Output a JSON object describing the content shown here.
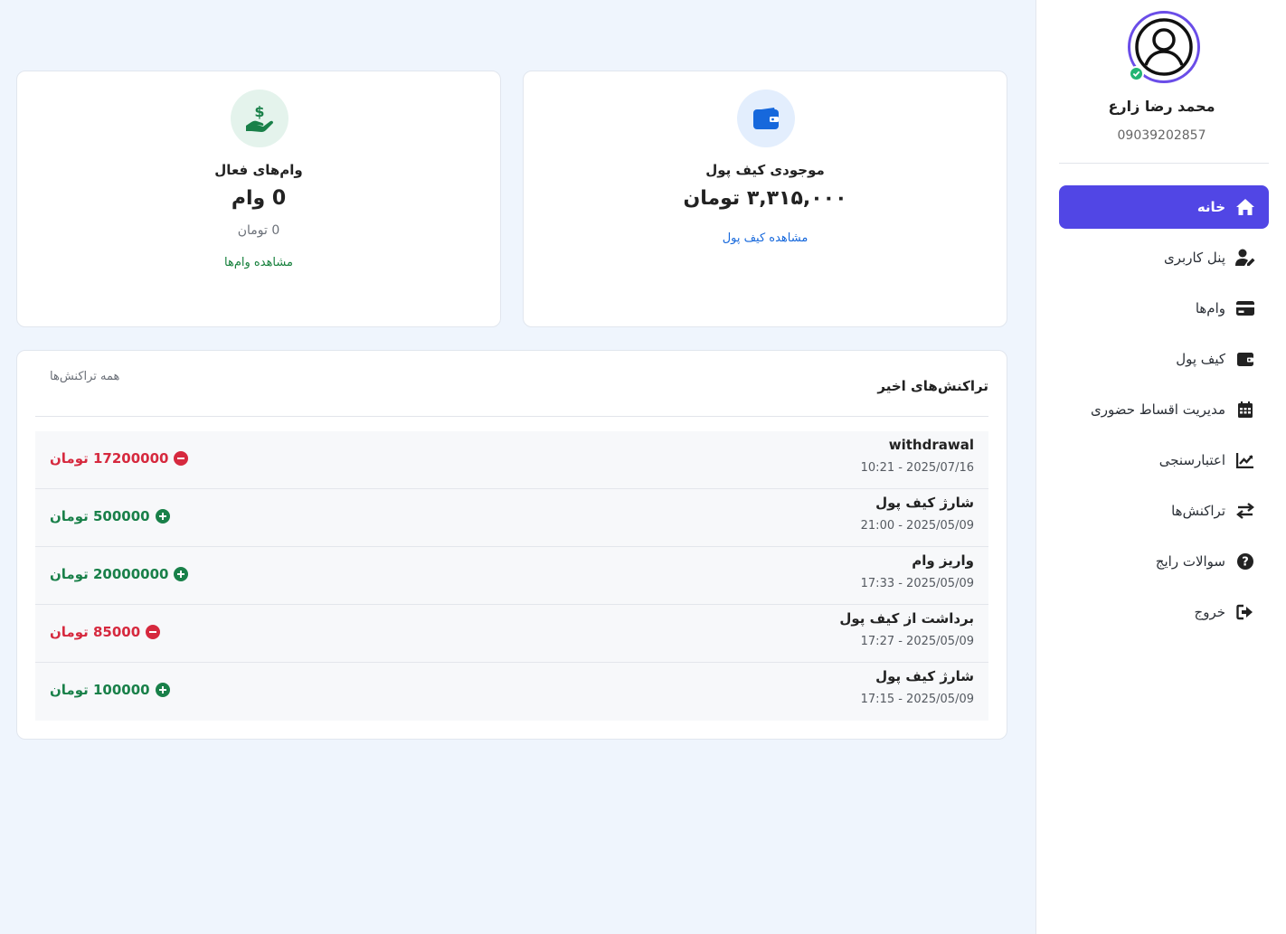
{
  "profile": {
    "name": "محمد رضا زارع",
    "phone": "09039202857"
  },
  "nav": {
    "items": [
      {
        "label": "خانه",
        "icon": "home-icon",
        "active": true
      },
      {
        "label": "پنل کاربری",
        "icon": "user-edit-icon",
        "active": false
      },
      {
        "label": "وام‌ها",
        "icon": "credit-card-icon",
        "active": false
      },
      {
        "label": "کیف پول",
        "icon": "wallet-icon",
        "active": false
      },
      {
        "label": "مدیریت اقساط حضوری",
        "icon": "calendar-icon",
        "active": false
      },
      {
        "label": "اعتبارسنجی",
        "icon": "chart-line-icon",
        "active": false
      },
      {
        "label": "تراکنش‌ها",
        "icon": "exchange-icon",
        "active": false
      },
      {
        "label": "سوالات رایج",
        "icon": "question-circle-icon",
        "active": false
      },
      {
        "label": "خروج",
        "icon": "sign-out-icon",
        "active": false
      }
    ]
  },
  "wallet_card": {
    "title": "موجودی کیف پول",
    "value": "۳,۳۱۵,۰۰۰ تومان",
    "link": "مشاهده کیف پول",
    "icon": "wallet-icon"
  },
  "loans_card": {
    "title": "وام‌های فعال",
    "value": "0 وام",
    "sub": "0 تومان",
    "link": "مشاهده وام‌ها",
    "icon": "hand-holding-dollar-icon"
  },
  "transactions": {
    "title": "تراکنش‌های اخیر",
    "all_link": "همه تراکنش‌ها",
    "rows": [
      {
        "name": "withdrawal",
        "date": "10:21 - 2025/07/16",
        "amount": "17200000 تومان",
        "type": "neg"
      },
      {
        "name": "شارژ کیف پول",
        "date": "21:00 - 2025/05/09",
        "amount": "500000 تومان",
        "type": "pos"
      },
      {
        "name": "واریز وام",
        "date": "17:33 - 2025/05/09",
        "amount": "20000000 تومان",
        "type": "pos"
      },
      {
        "name": "برداشت از کیف پول",
        "date": "17:27 - 2025/05/09",
        "amount": "85000 تومان",
        "type": "neg"
      },
      {
        "name": "شارژ کیف پول",
        "date": "17:15 - 2025/05/09",
        "amount": "100000 تومان",
        "type": "pos"
      }
    ]
  },
  "colors": {
    "accent": "#5146e5",
    "positive": "#198049",
    "negative": "#d6293e",
    "link_blue": "#1668dc",
    "background": "#eff5fd"
  }
}
